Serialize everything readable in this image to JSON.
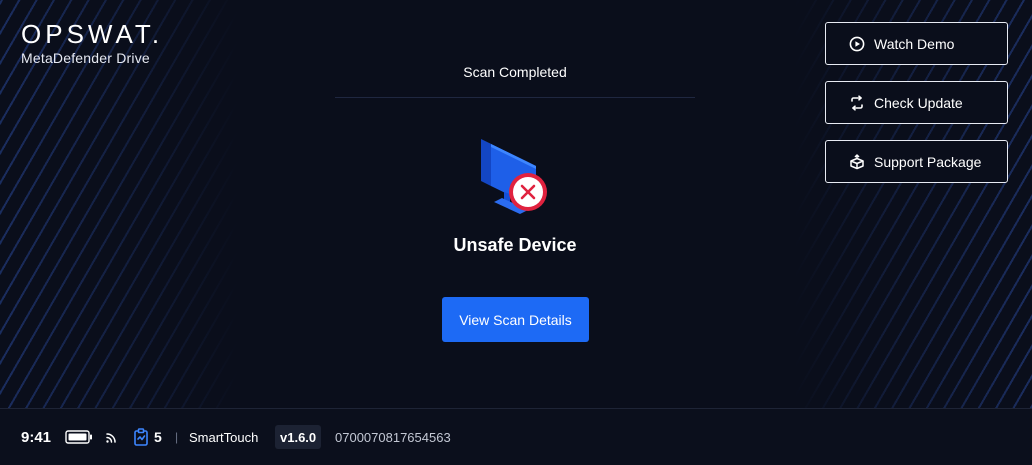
{
  "brand": {
    "logo_text": "OPSWAT.",
    "product_name": "MetaDefender Drive"
  },
  "scan": {
    "title": "Scan Completed",
    "status": "Unsafe Device",
    "view_button_label": "View Scan Details",
    "device_icon": "monitor-icon",
    "status_icon": "error-x-icon"
  },
  "side_actions": [
    {
      "label": "Watch Demo",
      "icon": "play-circle-icon"
    },
    {
      "label": "Check Update",
      "icon": "refresh-icon"
    },
    {
      "label": "Support Package",
      "icon": "package-icon"
    }
  ],
  "status_bar": {
    "time": "9:41",
    "battery_icon": "battery-icon",
    "signal_icon": "wireless-icon",
    "clipboard_icon": "clipboard-check-icon",
    "clipboard_count": "5",
    "separator": "|",
    "device_name": "SmartTouch",
    "version": "v1.6.0",
    "serial": "0700070817654563"
  },
  "colors": {
    "background": "#0a0e1b",
    "accent_blue": "#1d6af5",
    "stripe_blue": "#284696",
    "error_red": "#e0223f",
    "monitor_blue": "#1e5fe8"
  }
}
